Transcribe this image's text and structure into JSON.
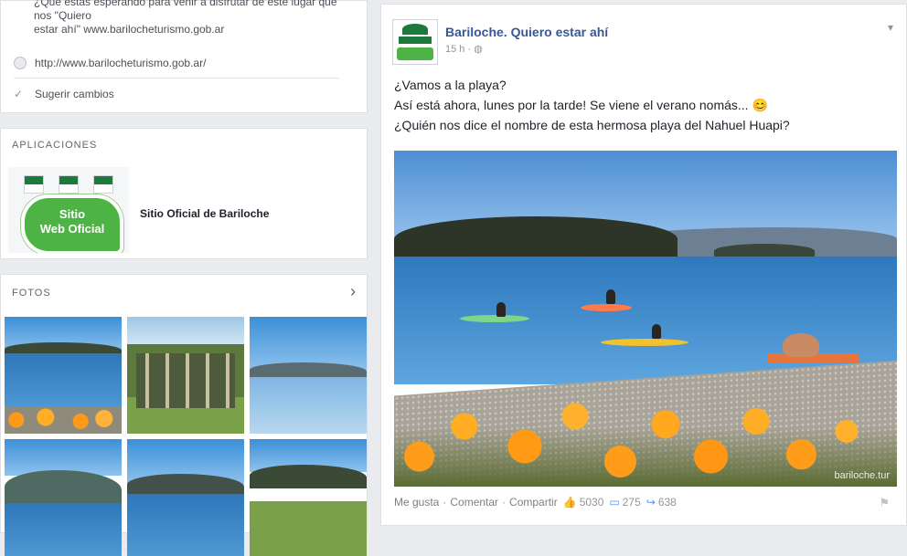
{
  "about": {
    "partial_line_1": "¿Qué estás esperando para venir a disfrutar de este lugar que nos \"Quiero",
    "partial_line_2": "estar ahí\" www.barilocheturismo.gob.ar",
    "website": "http://www.barilocheturismo.gob.ar/",
    "suggest_edits": "Sugerir cambios"
  },
  "apps": {
    "title": "APLICACIONES",
    "badge_line1": "Sitio",
    "badge_line2": "Web Oficial",
    "app_label": "Bariloche",
    "app_name": "Sitio Oficial de Bariloche"
  },
  "photos": {
    "title": "FOTOS",
    "arrow": "›"
  },
  "post": {
    "page_name": "Bariloche. Quiero estar ahí",
    "time": "15 h",
    "privacy_icon": "globe-icon",
    "text_lines": [
      "¿Vamos a la playa?",
      "Así está ahora, lunes por la tarde! Se viene el verano nomás... 😊",
      "¿Quién nos dice el nombre de esta hermosa playa del Nahuel Huapi?"
    ],
    "watermark": "bariloche.tur",
    "actions": {
      "like": "Me gusta",
      "comment": "Comentar",
      "share": "Compartir",
      "likes_count": "5030",
      "comments_count": "275",
      "shares_count": "638"
    }
  },
  "colors": {
    "page_bg": "#e9ebee",
    "link_blue": "#365899",
    "brand_green": "#4db344"
  }
}
